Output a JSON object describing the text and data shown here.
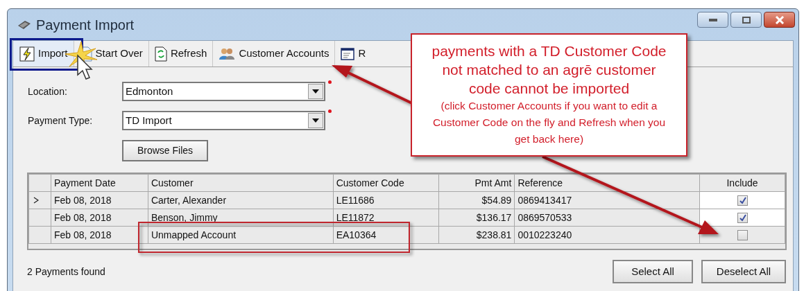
{
  "window": {
    "title": "Payment Import"
  },
  "toolbar": [
    {
      "label": "Import",
      "kind": "import",
      "focused": true
    },
    {
      "label": "Start Over",
      "kind": "reset",
      "focused": false
    },
    {
      "label": "Refresh",
      "kind": "refresh",
      "focused": false
    },
    {
      "label": "Customer Accounts",
      "kind": "accounts",
      "focused": false
    },
    {
      "label": "R",
      "kind": "report",
      "focused": false
    }
  ],
  "form": {
    "fields": [
      {
        "label": "Location:",
        "value": "Edmonton",
        "required": true
      },
      {
        "label": "Payment Type:",
        "value": "TD Import",
        "required": true
      }
    ],
    "browse_button": "Browse Files"
  },
  "grid": {
    "columns": [
      "Payment Date",
      "Customer",
      "Customer Code",
      "Pmt Amt",
      "Reference",
      "Include"
    ],
    "rows": [
      {
        "current": true,
        "payment_date": "Feb 08, 2018",
        "customer": "Carter, Alexander",
        "customer_code": "LE11686",
        "pmt_amt": "$54.89",
        "reference": "0869413417",
        "include": true
      },
      {
        "current": false,
        "payment_date": "Feb 08, 2018",
        "customer": "Benson, Jimmy",
        "customer_code": "LE11872",
        "pmt_amt": "$136.17",
        "reference": "0869570533",
        "include": true
      },
      {
        "current": false,
        "payment_date": "Feb 08, 2018",
        "customer": "Unmapped Account",
        "customer_code": "EA10364",
        "pmt_amt": "$238.81",
        "reference": "0010223240",
        "include": false
      }
    ]
  },
  "status": "2 Payments found",
  "buttons": [
    "Select All",
    "Deselect All"
  ],
  "callout": {
    "headline": "payments with a TD Customer Code not matched to an agrē customer code cannot be imported",
    "note": "(click Customer Accounts if you want to edit a Customer Code on the fly and Refresh when you get back here)"
  }
}
